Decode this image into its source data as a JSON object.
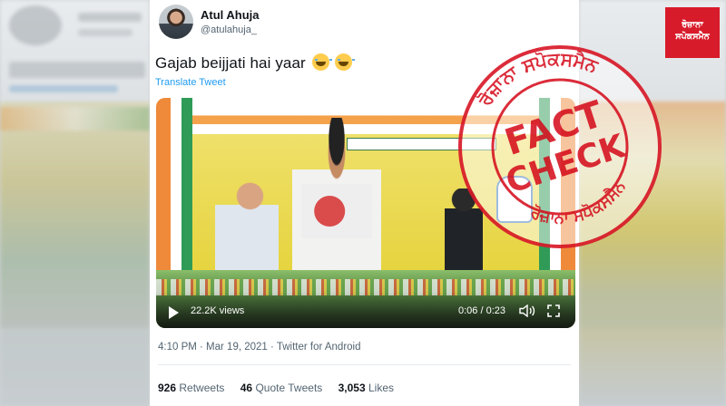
{
  "tweet": {
    "author_name": "Atul Ahuja",
    "author_handle": "@atulahuja_",
    "text": "Gajab beijjati hai yaar",
    "translate_label": "Translate Tweet",
    "emojis": [
      "loudly-crying-face",
      "face-with-tears-of-joy"
    ],
    "timestamp": "4:10 PM · Mar 19, 2021 · Twitter for Android"
  },
  "video": {
    "views": "22.2K views",
    "time": "0:06 / 0:23",
    "progress": 0.26
  },
  "stats": [
    {
      "count": "926",
      "label": "Retweets"
    },
    {
      "count": "46",
      "label": "Quote Tweets"
    },
    {
      "count": "3,053",
      "label": "Likes"
    }
  ],
  "stamp": {
    "line1": "FACT",
    "line2": "CHECK",
    "ring_text": "ਰੋਜ਼ਾਨਾ ਸਪੋਕਸਮੈਨ",
    "color": "#d81b2a"
  },
  "logo": {
    "line1": "ਰੋਜ਼ਾਨਾ",
    "line2": "ਸਪੋਕਸਮੈਨ",
    "color": "#d81b2a"
  }
}
